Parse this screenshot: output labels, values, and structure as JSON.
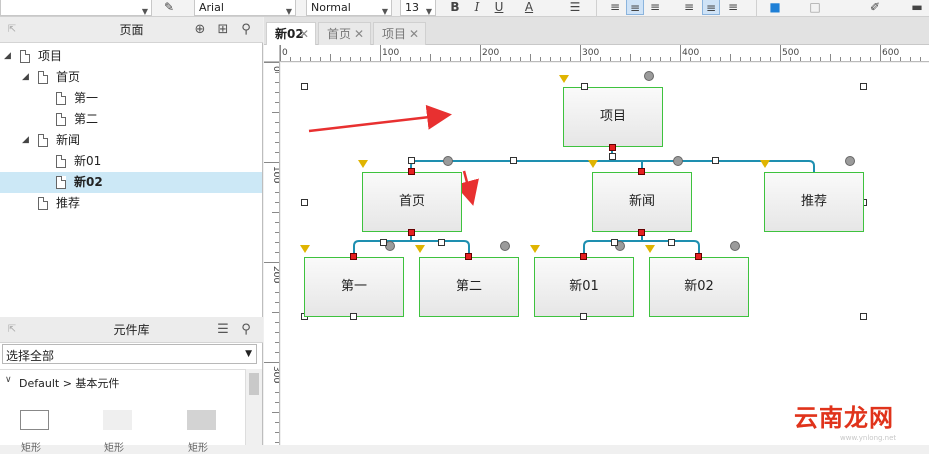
{
  "toolbar": {
    "font_family": "Arial",
    "font_style": "Normal",
    "font_size": "13",
    "bold_label": "B",
    "italic_label": "I",
    "underline_label": "U",
    "text_color_label": "A"
  },
  "pages_panel": {
    "title": "页面",
    "tree": [
      {
        "label": "项目",
        "level": 0,
        "expanded": true,
        "selected": false
      },
      {
        "label": "首页",
        "level": 1,
        "expanded": true,
        "selected": false
      },
      {
        "label": "第一",
        "level": 2,
        "selected": false
      },
      {
        "label": "第二",
        "level": 2,
        "selected": false
      },
      {
        "label": "新闻",
        "level": 1,
        "expanded": true,
        "selected": false
      },
      {
        "label": "新01",
        "level": 2,
        "selected": false
      },
      {
        "label": "新02",
        "level": 2,
        "selected": true
      },
      {
        "label": "推荐",
        "level": 1,
        "selected": false
      }
    ]
  },
  "library_panel": {
    "title": "元件库",
    "filter_value": "选择全部",
    "category": "Default > 基本元件",
    "widget_labels": [
      "矩形",
      "矩形",
      "矩形"
    ]
  },
  "tabs": [
    {
      "label": "新02",
      "active": true
    },
    {
      "label": "首页",
      "active": false
    },
    {
      "label": "项目",
      "active": false
    }
  ],
  "ruler": {
    "h_ticks": [
      "0",
      "100",
      "200",
      "300",
      "400",
      "500",
      "600"
    ],
    "v_ticks": [
      "0",
      "100",
      "200",
      "300"
    ]
  },
  "sitemap": {
    "root": "项目",
    "level1": [
      "首页",
      "新闻",
      "推荐"
    ],
    "level2": [
      "第一",
      "第二",
      "新01",
      "新02"
    ]
  },
  "colors": {
    "node_border": "#3ec23e",
    "connector": "#1e8fb0",
    "arrow": "#e83030",
    "selection_row": "#cce8f6"
  },
  "watermark": {
    "text": "云南龙网",
    "subtext": "www.ynlong.net"
  }
}
